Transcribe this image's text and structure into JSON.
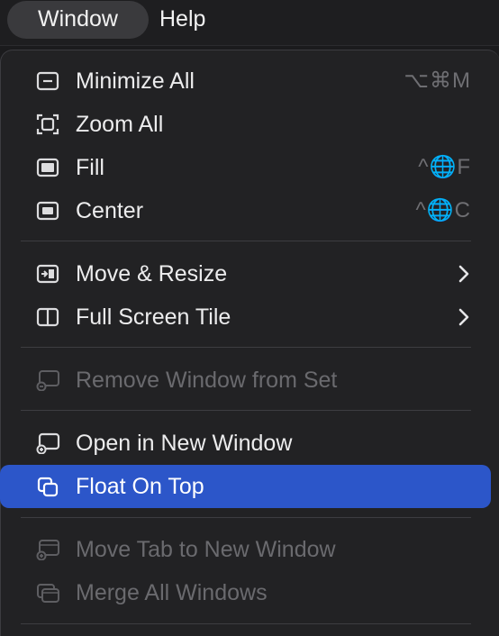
{
  "menubar": {
    "window_label": "Window",
    "help_label": "Help"
  },
  "menu": {
    "items": [
      {
        "label": "Minimize All",
        "shortcut": "⌥⌘M",
        "icon": "minimize-icon"
      },
      {
        "label": "Zoom All",
        "shortcut": "",
        "icon": "zoom-icon"
      },
      {
        "label": "Fill",
        "shortcut": "^🌐F",
        "icon": "fill-icon"
      },
      {
        "label": "Center",
        "shortcut": "^🌐C",
        "icon": "center-icon"
      },
      {
        "label": "Move & Resize",
        "submenu": true,
        "icon": "move-resize-icon"
      },
      {
        "label": "Full Screen Tile",
        "submenu": true,
        "icon": "full-screen-tile-icon"
      },
      {
        "label": "Remove Window from Set",
        "disabled": true,
        "icon": "remove-window-icon"
      },
      {
        "label": "Open in New Window",
        "icon": "open-new-window-icon"
      },
      {
        "label": "Float On Top",
        "selected": true,
        "icon": "float-on-top-icon"
      },
      {
        "label": "Move Tab to New Window",
        "disabled": true,
        "icon": "move-tab-icon"
      },
      {
        "label": "Merge All Windows",
        "disabled": true,
        "icon": "merge-windows-icon"
      }
    ]
  },
  "colors": {
    "highlight": "#2c56c9",
    "menu_bg": "#222224",
    "text": "#ececed",
    "disabled_text": "#6a6a6e",
    "shortcut_text": "#6f6f73"
  }
}
